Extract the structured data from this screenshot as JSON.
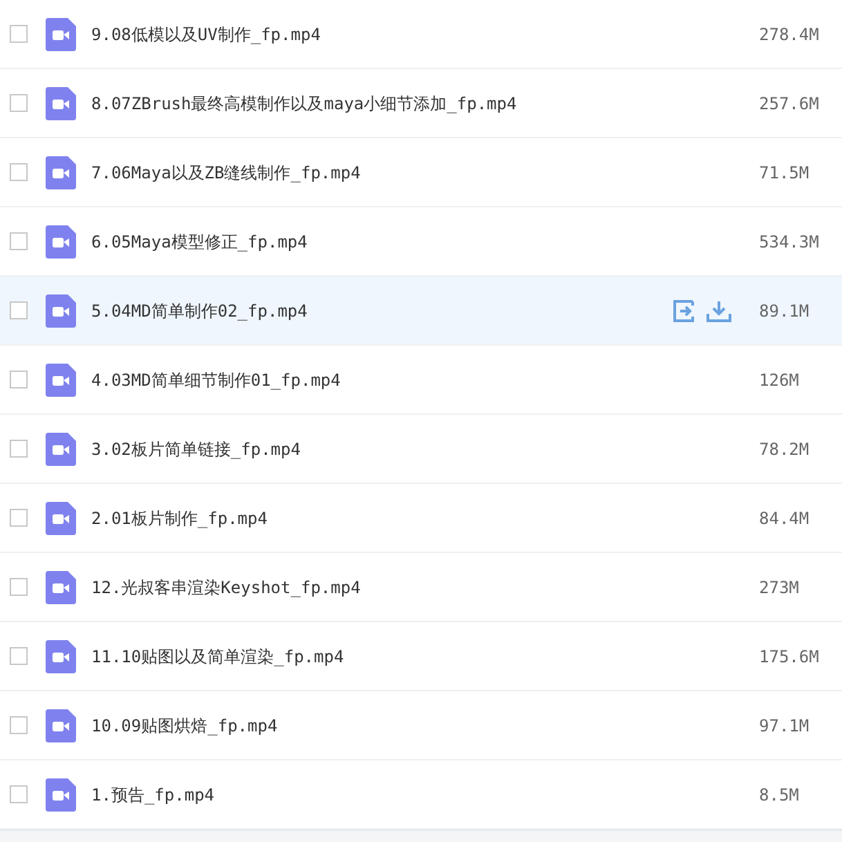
{
  "files": [
    {
      "name": "9.08低模以及UV制作_fp.mp4",
      "size": "278.4M",
      "checked": false,
      "hovered": false
    },
    {
      "name": "8.07ZBrush最终高模制作以及maya小细节添加_fp.mp4",
      "size": "257.6M",
      "checked": false,
      "hovered": false
    },
    {
      "name": "7.06Maya以及ZB缝线制作_fp.mp4",
      "size": "71.5M",
      "checked": false,
      "hovered": false
    },
    {
      "name": "6.05Maya模型修正_fp.mp4",
      "size": "534.3M",
      "checked": false,
      "hovered": false
    },
    {
      "name": "5.04MD简单制作02_fp.mp4",
      "size": "89.1M",
      "checked": false,
      "hovered": true
    },
    {
      "name": "4.03MD简单细节制作01_fp.mp4",
      "size": "126M",
      "checked": false,
      "hovered": false
    },
    {
      "name": "3.02板片简单链接_fp.mp4",
      "size": "78.2M",
      "checked": false,
      "hovered": false
    },
    {
      "name": "2.01板片制作_fp.mp4",
      "size": "84.4M",
      "checked": false,
      "hovered": false
    },
    {
      "name": "12.光叔客串渲染Keyshot_fp.mp4",
      "size": "273M",
      "checked": false,
      "hovered": false
    },
    {
      "name": "11.10贴图以及简单渲染_fp.mp4",
      "size": "175.6M",
      "checked": false,
      "hovered": false
    },
    {
      "name": "10.09贴图烘焙_fp.mp4",
      "size": "97.1M",
      "checked": false,
      "hovered": false
    },
    {
      "name": "1.预告_fp.mp4",
      "size": "8.5M",
      "checked": false,
      "hovered": false
    }
  ]
}
